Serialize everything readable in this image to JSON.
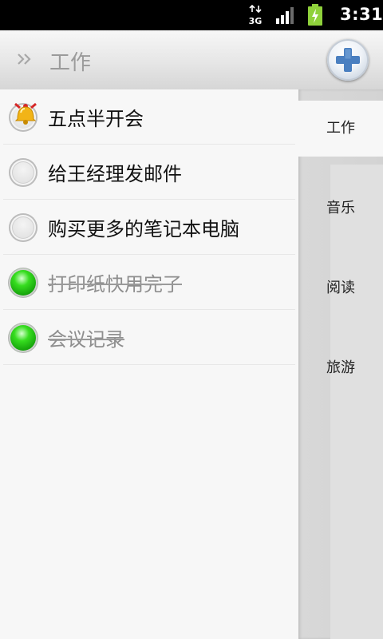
{
  "status_bar": {
    "network_icon": "3g-data-icon",
    "signal_icon": "signal-strength-icon",
    "battery_icon": "battery-charging-icon",
    "time": "3:31"
  },
  "header": {
    "title": "工作",
    "expand_icon": "double-chevron-right-icon",
    "add_icon": "plus-icon"
  },
  "tasks": [
    {
      "label": "五点半开会",
      "state": "alarm"
    },
    {
      "label": "给王经理发邮件",
      "state": "open"
    },
    {
      "label": "购买更多的笔记本电脑",
      "state": "open"
    },
    {
      "label": "打印纸快用完了",
      "state": "done"
    },
    {
      "label": "会议记录",
      "state": "done"
    }
  ],
  "categories": [
    {
      "label": "工作",
      "active": true
    },
    {
      "label": "音乐",
      "active": false
    },
    {
      "label": "阅读",
      "active": false
    },
    {
      "label": "旅游",
      "active": false
    }
  ],
  "colors": {
    "done_green": "#22c414",
    "accent_blue": "#4a7fc0",
    "bell_gold": "#f2b417"
  }
}
